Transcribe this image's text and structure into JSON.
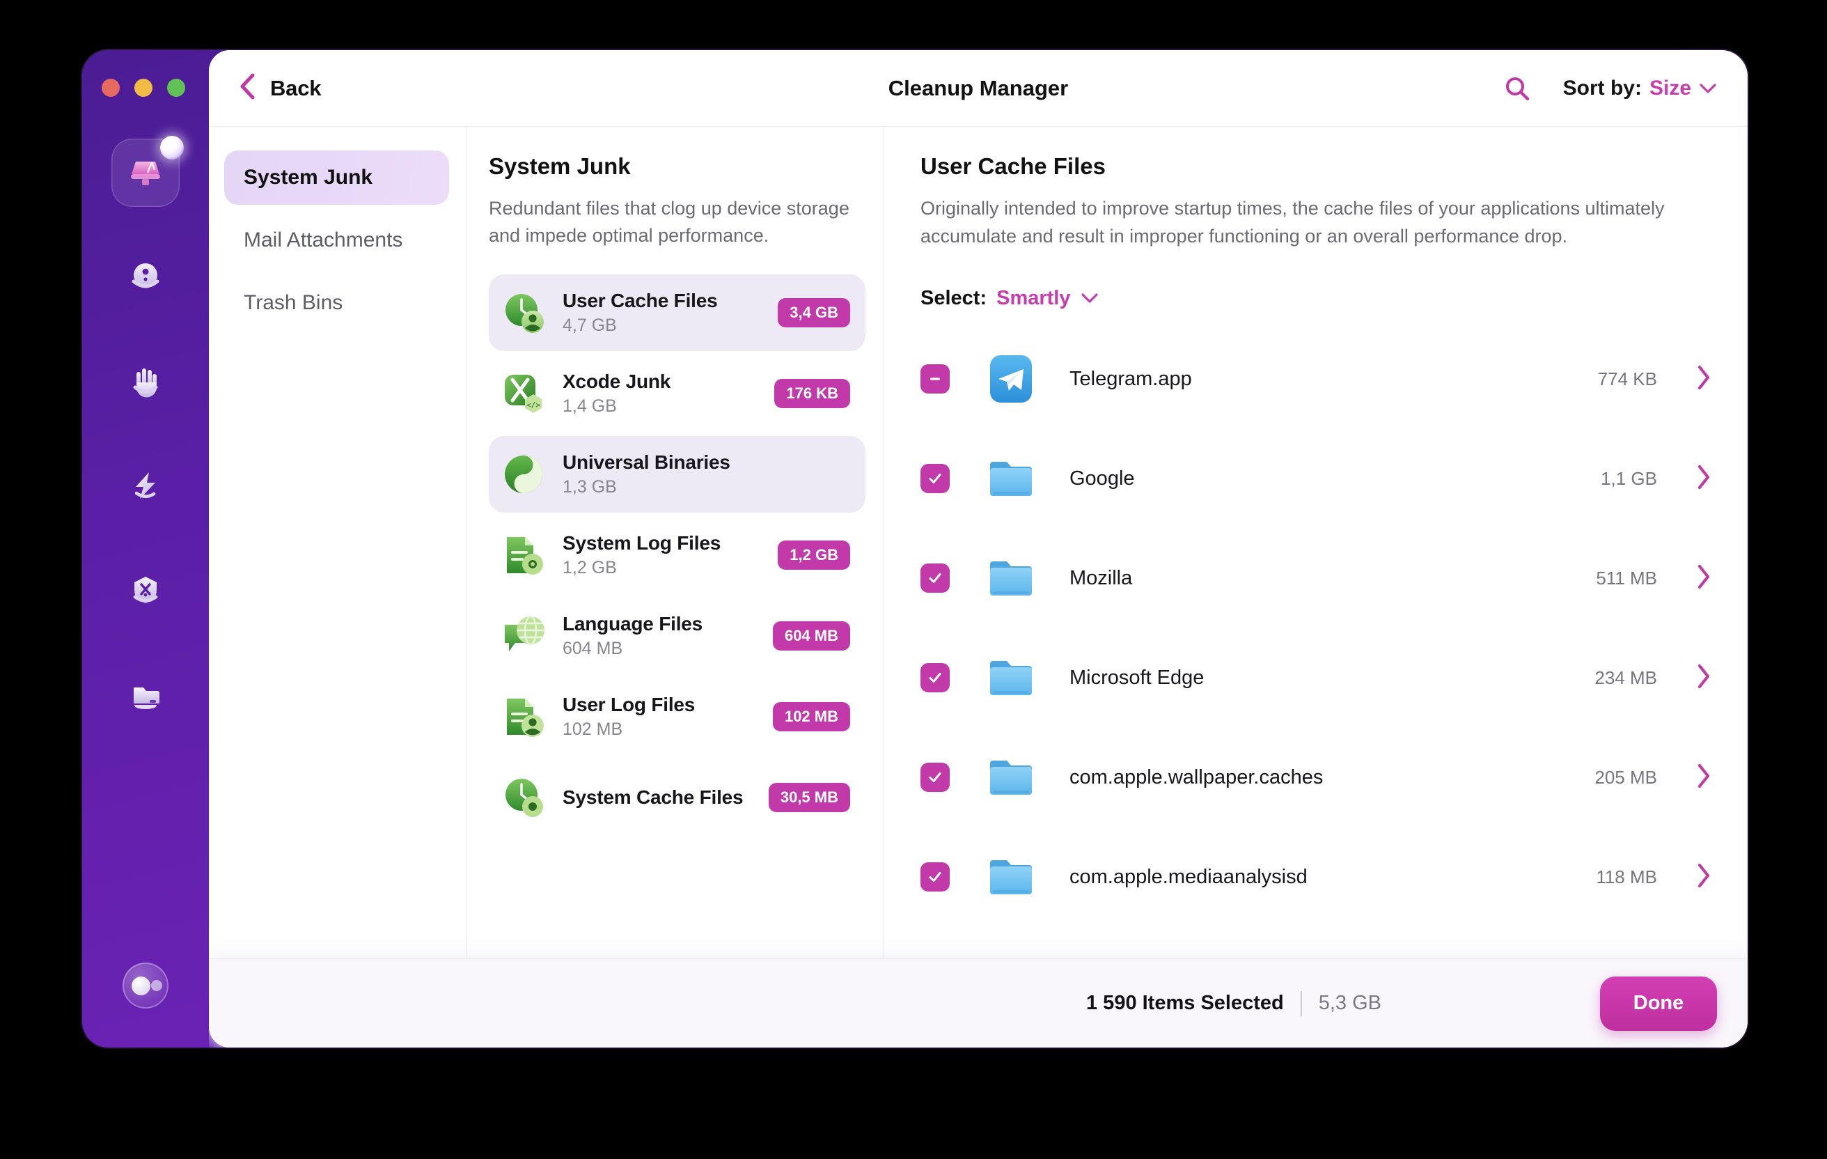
{
  "window": {
    "title": "Cleanup Manager",
    "traffic_lights": [
      "close-red",
      "minimize-yellow",
      "maximize-green"
    ],
    "accent": "#c63dad",
    "badge_color": "#c23aa9",
    "sidebar_purple": "#5a1fa6"
  },
  "topbar": {
    "back_label": "Back",
    "back_icon": "chevron-left-icon",
    "search_icon": "search-icon",
    "sort_label": "Sort by:",
    "sort_value": "Size",
    "sort_chevron": "chevron-down-icon"
  },
  "rail": {
    "items": [
      {
        "icon": "cleanup-broom-icon",
        "active": true,
        "notification": true
      },
      {
        "icon": "performance-face-icon",
        "active": false,
        "notification": false
      },
      {
        "icon": "hand-privacy-icon",
        "active": false,
        "notification": false
      },
      {
        "icon": "lightning-speed-icon",
        "active": false,
        "notification": false
      },
      {
        "icon": "shield-applications-icon",
        "active": false,
        "notification": false
      },
      {
        "icon": "folder-files-icon",
        "active": false,
        "notification": false
      }
    ],
    "account_icon": "account-avatar-icon"
  },
  "nav": {
    "items": [
      {
        "label": "System Junk",
        "active": true
      },
      {
        "label": "Mail Attachments",
        "active": false
      },
      {
        "label": "Trash Bins",
        "active": false
      }
    ]
  },
  "categories": {
    "heading": "System Junk",
    "description": "Redundant files that clog up device storage and impede optimal performance.",
    "items": [
      {
        "name": "User Cache Files",
        "size": "4,7 GB",
        "badge": "3,4 GB",
        "selected": true,
        "icon": "user-cache-icon"
      },
      {
        "name": "Xcode Junk",
        "size": "1,4 GB",
        "badge": "176 KB",
        "selected": false,
        "icon": "xcode-junk-icon"
      },
      {
        "name": "Universal Binaries",
        "size": "1,3 GB",
        "badge": "",
        "selected": true,
        "icon": "universal-binaries-icon"
      },
      {
        "name": "System Log Files",
        "size": "1,2 GB",
        "badge": "1,2 GB",
        "selected": false,
        "icon": "system-log-icon"
      },
      {
        "name": "Language Files",
        "size": "604 MB",
        "badge": "604 MB",
        "selected": false,
        "icon": "language-files-icon"
      },
      {
        "name": "User Log Files",
        "size": "102 MB",
        "badge": "102 MB",
        "selected": false,
        "icon": "user-log-icon"
      },
      {
        "name": "System Cache Files",
        "size": "",
        "badge": "30,5 MB",
        "selected": false,
        "icon": "system-cache-icon"
      }
    ]
  },
  "detail": {
    "heading": "User Cache Files",
    "description": "Originally intended to improve startup times, the cache files of your applications ultimately accumulate and result in improper functioning or an overall performance drop.",
    "select_label": "Select:",
    "select_value": "Smartly",
    "select_chevron": "chevron-down-icon",
    "files": [
      {
        "name": "Telegram.app",
        "size": "774 KB",
        "check": "partial",
        "icon": "telegram-app-icon"
      },
      {
        "name": "Google",
        "size": "1,1 GB",
        "check": "checked",
        "icon": "folder-icon"
      },
      {
        "name": "Mozilla",
        "size": "511 MB",
        "check": "checked",
        "icon": "folder-icon"
      },
      {
        "name": "Microsoft Edge",
        "size": "234 MB",
        "check": "checked",
        "icon": "folder-icon"
      },
      {
        "name": "com.apple.wallpaper.caches",
        "size": "205 MB",
        "check": "checked",
        "icon": "folder-icon"
      },
      {
        "name": "com.apple.mediaanalysisd",
        "size": "118 MB",
        "check": "checked",
        "icon": "folder-icon"
      }
    ]
  },
  "footer": {
    "items_selected": "1 590 Items Selected",
    "total_size": "5,3 GB",
    "done_label": "Done"
  }
}
